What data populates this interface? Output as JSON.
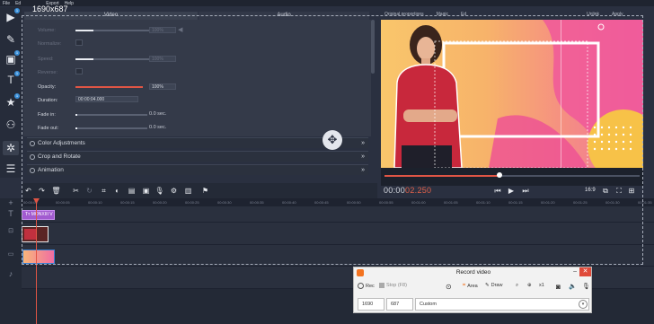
{
  "menu": {
    "items": [
      "File",
      "Ed",
      "Export",
      "Help"
    ]
  },
  "overlay": {
    "dimensions": "1690x687"
  },
  "left_tools": [
    {
      "icon": "import-icon",
      "glyph": "▶",
      "badge": "1"
    },
    {
      "icon": "magic-wand-icon",
      "glyph": "✎",
      "badge": ""
    },
    {
      "icon": "filters-icon",
      "glyph": "▣",
      "badge": "1"
    },
    {
      "icon": "titles-icon",
      "glyph": "T",
      "badge": "1"
    },
    {
      "icon": "stickers-icon",
      "glyph": "★",
      "badge": "1"
    },
    {
      "icon": "transitions-icon",
      "glyph": "⚇",
      "badge": ""
    },
    {
      "icon": "more-tools-icon",
      "glyph": "✲",
      "badge": ""
    },
    {
      "icon": "list-icon",
      "glyph": "☰",
      "badge": ""
    }
  ],
  "tabs": {
    "video": "Video",
    "audio": "Audio"
  },
  "properties": {
    "volume": {
      "label": "Volume:",
      "value": "100%"
    },
    "normalize": {
      "label": "Normalize:"
    },
    "speed": {
      "label": "Speed:",
      "value": "100%"
    },
    "reverse": {
      "label": "Reverse:"
    },
    "opacity": {
      "label": "Opacity:",
      "value": "100%"
    },
    "duration": {
      "label": "Duration:",
      "value": "00:00:04.000"
    },
    "fade_in": {
      "label": "Fade in:",
      "value": "0.0 sec."
    },
    "fade_out": {
      "label": "Fade out:",
      "value": "0.0 sec."
    }
  },
  "sections": [
    "Color Adjustments",
    "Crop and Rotate",
    "Animation"
  ],
  "preview": {
    "top_labels": [
      "Original proportions",
      "Magic",
      "Ed",
      "Unlink",
      "Apply"
    ],
    "timecode_white": "00:00",
    "timecode_red": "02.250",
    "aspect": "16:9",
    "progress_fraction": 0.45
  },
  "timeline": {
    "ruler_ticks": [
      "00:00:00",
      "00:00:05",
      "00:00:10",
      "00:00:15",
      "00:00:20",
      "00:00:25",
      "00:00:30",
      "00:00:35",
      "00:00:40",
      "00:00:45",
      "00:00:50",
      "00:00:55",
      "00:01:00",
      "00:01:05",
      "00:01:10",
      "00:01:15",
      "00:01:20",
      "00:01:25",
      "00:01:30",
      "00:01:35"
    ],
    "title_clip": "Tт MONXIII V"
  },
  "record_dialog": {
    "title": "Record video",
    "rec": "Rec",
    "stop": "Stop (F8)",
    "area": "Area",
    "draw": "Draw",
    "zoom": "x1",
    "width": "1690",
    "height": "687",
    "mode": "Custom",
    "minimize": "–",
    "close": "✕"
  },
  "colors": {
    "accent_red": "#e05545",
    "rec_orange": "#f37320",
    "title_clip": "#a25bd0"
  }
}
